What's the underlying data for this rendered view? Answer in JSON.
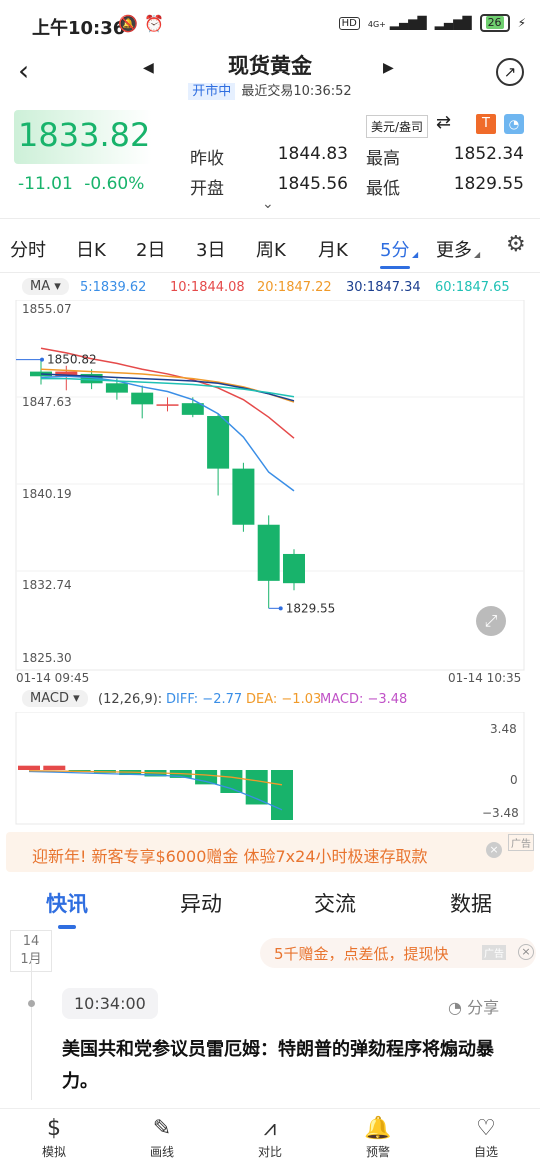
{
  "status_bar": {
    "time": "上午10:36",
    "hd": "HD",
    "signal_labels": [
      "4G+",
      "4G"
    ],
    "battery": "26"
  },
  "header": {
    "title": "现货黄金",
    "market_status": "开市中",
    "last_trade": "最近交易10:36:52"
  },
  "quote": {
    "price": "1833.82",
    "change": "-11.01",
    "change_pct": "-0.60%",
    "unit": "美元/盎司",
    "stats": [
      {
        "label": "昨收",
        "value": "1844.83"
      },
      {
        "label": "最高",
        "value": "1852.34"
      },
      {
        "label": "开盘",
        "value": "1845.56"
      },
      {
        "label": "最低",
        "value": "1829.55"
      }
    ]
  },
  "period_tabs": [
    "分时",
    "日K",
    "2日",
    "3日",
    "周K",
    "月K",
    "5分",
    "更多"
  ],
  "active_period": "5分",
  "ma": {
    "label": "MA",
    "items": [
      {
        "text": "5:1839.62",
        "color": "#3a8ee6"
      },
      {
        "text": "10:1844.08",
        "color": "#e54a4a"
      },
      {
        "text": "20:1847.22",
        "color": "#f09a2a"
      },
      {
        "text": "30:1847.34",
        "color": "#1c3f8f"
      },
      {
        "text": "60:1847.65",
        "color": "#20c1b5"
      }
    ]
  },
  "chart_data": {
    "type": "candlestick",
    "x_start": "01-14 09:45",
    "x_end": "01-14 10:35",
    "y_ticks": [
      "1855.07",
      "1847.63",
      "1840.19",
      "1832.74",
      "1825.30"
    ],
    "ylim": [
      1825.3,
      1855.07
    ],
    "high_marker": "1850.82",
    "low_marker": "1829.55",
    "candles": [
      {
        "o": 1849.8,
        "c": 1849.4,
        "h": 1850.82,
        "l": 1848.7
      },
      {
        "o": 1849.4,
        "c": 1849.8,
        "h": 1850.3,
        "l": 1848.2
      },
      {
        "o": 1849.6,
        "c": 1848.8,
        "h": 1850.0,
        "l": 1848.3
      },
      {
        "o": 1848.8,
        "c": 1848.0,
        "h": 1849.2,
        "l": 1847.4
      },
      {
        "o": 1848.0,
        "c": 1847.0,
        "h": 1848.6,
        "l": 1845.8
      },
      {
        "o": 1847.0,
        "c": 1847.0,
        "h": 1847.6,
        "l": 1846.4
      },
      {
        "o": 1847.1,
        "c": 1846.1,
        "h": 1847.6,
        "l": 1845.9
      },
      {
        "o": 1846.0,
        "c": 1841.5,
        "h": 1846.2,
        "l": 1839.2
      },
      {
        "o": 1841.5,
        "c": 1836.7,
        "h": 1842.0,
        "l": 1836.1
      },
      {
        "o": 1836.7,
        "c": 1831.9,
        "h": 1837.5,
        "l": 1829.55
      },
      {
        "o": 1834.2,
        "c": 1831.7,
        "h": 1834.6,
        "l": 1831.1
      }
    ],
    "ma_lines": [
      {
        "name": "5",
        "color": "#3a8ee6",
        "values": [
          1849.3,
          1849.4,
          1849.3,
          1849.0,
          1848.5,
          1848.1,
          1847.4,
          1846.2,
          1844.2,
          1841.2,
          1839.6
        ]
      },
      {
        "name": "10",
        "color": "#e54a4a",
        "values": [
          1851.8,
          1851.4,
          1850.9,
          1850.5,
          1850.0,
          1849.6,
          1849.1,
          1848.4,
          1847.4,
          1845.9,
          1844.1
        ]
      },
      {
        "name": "20",
        "color": "#f09a2a",
        "values": [
          1850.0,
          1849.9,
          1849.8,
          1849.7,
          1849.6,
          1849.4,
          1849.2,
          1848.9,
          1848.5,
          1847.9,
          1847.2
        ]
      },
      {
        "name": "30",
        "color": "#1c3f8f",
        "values": [
          1849.6,
          1849.5,
          1849.4,
          1849.3,
          1849.2,
          1849.1,
          1849.0,
          1848.8,
          1848.4,
          1847.9,
          1847.3
        ]
      },
      {
        "name": "60",
        "color": "#20c1b5",
        "values": [
          1849.2,
          1849.2,
          1849.1,
          1849.0,
          1848.9,
          1848.8,
          1848.7,
          1848.5,
          1848.3,
          1848.0,
          1847.65
        ]
      }
    ]
  },
  "macd": {
    "label": "MACD",
    "params": "(12,26,9):",
    "diff": "DIFF: −2.77",
    "dea": "DEA: −1.03",
    "macd": "MACD: −3.48",
    "ticks": [
      "3.48",
      "0",
      "−3.48"
    ],
    "bars": [
      0.3,
      0.3,
      -0.05,
      -0.2,
      -0.35,
      -0.45,
      -0.55,
      -1.0,
      -1.6,
      -2.4,
      -3.48
    ],
    "diff_values": [
      -0.1,
      -0.15,
      -0.2,
      -0.25,
      -0.3,
      -0.35,
      -0.45,
      -0.8,
      -1.3,
      -2.0,
      -2.77
    ],
    "dea_values": [
      -0.05,
      -0.07,
      -0.1,
      -0.12,
      -0.15,
      -0.2,
      -0.25,
      -0.35,
      -0.5,
      -0.75,
      -1.03
    ]
  },
  "ad": {
    "text": "迎新年! 新客专享$6000赠金  体验7x24小时极速存取款",
    "tag": "广告"
  },
  "news_tabs": [
    "快讯",
    "异动",
    "交流",
    "数据"
  ],
  "date_box": {
    "day": "14",
    "month": "1月"
  },
  "promo": {
    "text": "5千赠金，点差低，提现快",
    "tag": "广告"
  },
  "news_item": {
    "time": "10:34:00",
    "share": "分享",
    "headline": "美国共和党参议员雷厄姆：特朗普的弹劾程序将煽动暴力。"
  },
  "bottom_nav": [
    {
      "label": "模拟",
      "icon": "dollar-icon"
    },
    {
      "label": "画线",
      "icon": "pen-icon"
    },
    {
      "label": "对比",
      "icon": "chart-compare-icon"
    },
    {
      "label": "预警",
      "icon": "bell-icon"
    },
    {
      "label": "自选",
      "icon": "heart-plus-icon"
    }
  ]
}
